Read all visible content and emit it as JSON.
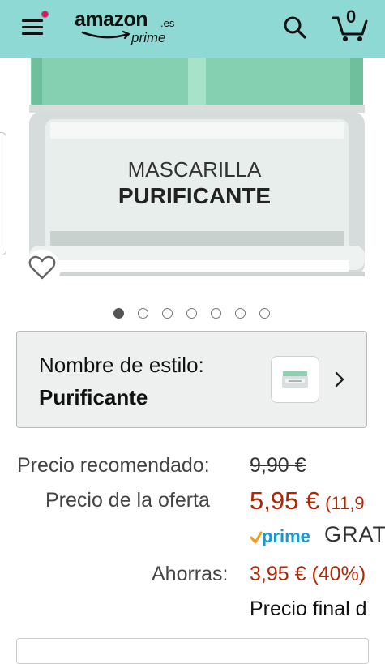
{
  "header": {
    "logo_text": "amazon",
    "logo_tld": ".es",
    "logo_prime": "prime",
    "cart_count": "0",
    "background_color": "#8fd9d4",
    "menu_notification_color": "#e4145c",
    "icons": [
      "menu-icon",
      "search-icon",
      "cart-icon"
    ]
  },
  "product_image": {
    "line1": "MASCARILLA",
    "line2": "PURIFICANTE",
    "jar_lid_color": "#85cfb0",
    "jar_body_color": "#e7eeec",
    "wishlist_icon": "heart-outline-icon"
  },
  "carousel": {
    "total": 7,
    "active_index": 0
  },
  "style_selector": {
    "label": "Nombre de estilo:",
    "value": "Purificante",
    "chevron_icon": "chevron-right-icon"
  },
  "pricing": {
    "recommended_label": "Precio recomendado:",
    "recommended_value": "9,90 €",
    "offer_label": "Precio de la oferta",
    "offer_value": "5,95 €",
    "unit_price": "(11,9",
    "prime_label": "prime",
    "shipping": "GRAT",
    "savings_label": "Ahorras:",
    "savings_value": "3,95 € (40%)",
    "final_price_label": "Precio final d",
    "price_color": "#b12704",
    "prime_color": "#1399d6"
  }
}
